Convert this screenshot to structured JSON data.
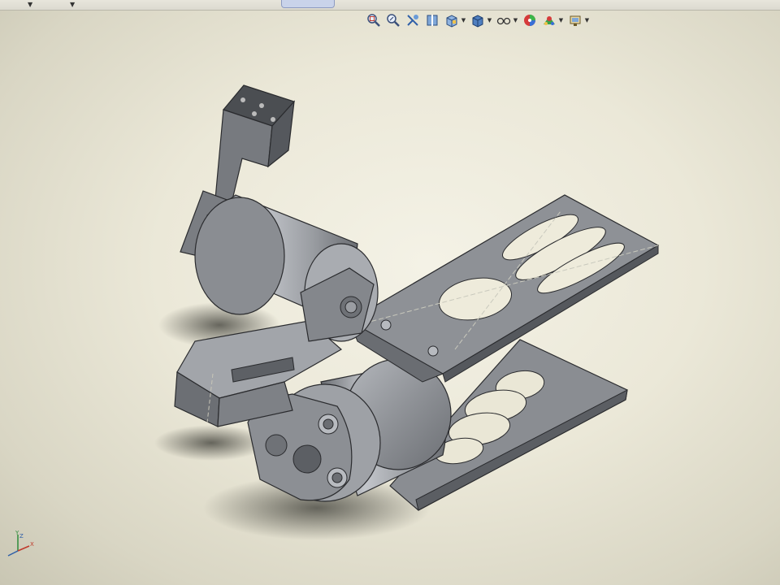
{
  "app": {
    "view": "3D model viewport"
  },
  "toolbar": {
    "tools": [
      {
        "icon": "zoom-to-fit-icon"
      },
      {
        "icon": "zoom-to-area-icon"
      },
      {
        "icon": "previous-view-icon"
      },
      {
        "icon": "section-view-icon"
      },
      {
        "icon": "view-orientation-icon",
        "dropdown": true
      },
      {
        "icon": "display-style-icon",
        "dropdown": true
      },
      {
        "icon": "hide-show-items-icon",
        "dropdown": true
      },
      {
        "icon": "edit-appearance-icon"
      },
      {
        "icon": "apply-scene-icon",
        "dropdown": true
      },
      {
        "icon": "view-settings-icon",
        "dropdown": true
      }
    ]
  },
  "triad": {
    "axes": [
      "Y",
      "Z",
      "X"
    ]
  },
  "colors": {
    "part": "#8f9297",
    "part_light": "#b7babf",
    "part_dark": "#5b5e63",
    "edge": "#2a2b2e",
    "background": "#ebe8d8"
  }
}
